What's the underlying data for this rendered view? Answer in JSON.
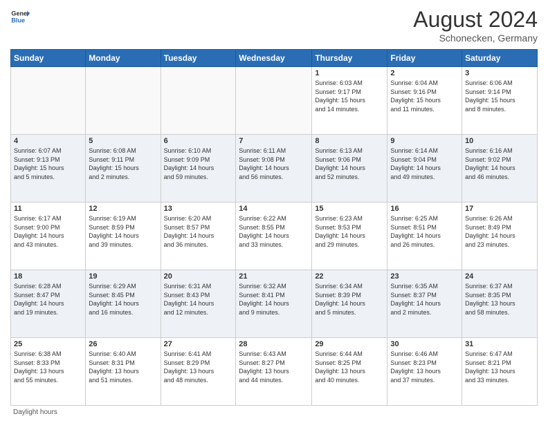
{
  "header": {
    "logo_general": "General",
    "logo_blue": "Blue",
    "month_year": "August 2024",
    "location": "Schonecken, Germany"
  },
  "days_of_week": [
    "Sunday",
    "Monday",
    "Tuesday",
    "Wednesday",
    "Thursday",
    "Friday",
    "Saturday"
  ],
  "weeks": [
    [
      {
        "day": "",
        "info": ""
      },
      {
        "day": "",
        "info": ""
      },
      {
        "day": "",
        "info": ""
      },
      {
        "day": "",
        "info": ""
      },
      {
        "day": "1",
        "info": "Sunrise: 6:03 AM\nSunset: 9:17 PM\nDaylight: 15 hours\nand 14 minutes."
      },
      {
        "day": "2",
        "info": "Sunrise: 6:04 AM\nSunset: 9:16 PM\nDaylight: 15 hours\nand 11 minutes."
      },
      {
        "day": "3",
        "info": "Sunrise: 6:06 AM\nSunset: 9:14 PM\nDaylight: 15 hours\nand 8 minutes."
      }
    ],
    [
      {
        "day": "4",
        "info": "Sunrise: 6:07 AM\nSunset: 9:13 PM\nDaylight: 15 hours\nand 5 minutes."
      },
      {
        "day": "5",
        "info": "Sunrise: 6:08 AM\nSunset: 9:11 PM\nDaylight: 15 hours\nand 2 minutes."
      },
      {
        "day": "6",
        "info": "Sunrise: 6:10 AM\nSunset: 9:09 PM\nDaylight: 14 hours\nand 59 minutes."
      },
      {
        "day": "7",
        "info": "Sunrise: 6:11 AM\nSunset: 9:08 PM\nDaylight: 14 hours\nand 56 minutes."
      },
      {
        "day": "8",
        "info": "Sunrise: 6:13 AM\nSunset: 9:06 PM\nDaylight: 14 hours\nand 52 minutes."
      },
      {
        "day": "9",
        "info": "Sunrise: 6:14 AM\nSunset: 9:04 PM\nDaylight: 14 hours\nand 49 minutes."
      },
      {
        "day": "10",
        "info": "Sunrise: 6:16 AM\nSunset: 9:02 PM\nDaylight: 14 hours\nand 46 minutes."
      }
    ],
    [
      {
        "day": "11",
        "info": "Sunrise: 6:17 AM\nSunset: 9:00 PM\nDaylight: 14 hours\nand 43 minutes."
      },
      {
        "day": "12",
        "info": "Sunrise: 6:19 AM\nSunset: 8:59 PM\nDaylight: 14 hours\nand 39 minutes."
      },
      {
        "day": "13",
        "info": "Sunrise: 6:20 AM\nSunset: 8:57 PM\nDaylight: 14 hours\nand 36 minutes."
      },
      {
        "day": "14",
        "info": "Sunrise: 6:22 AM\nSunset: 8:55 PM\nDaylight: 14 hours\nand 33 minutes."
      },
      {
        "day": "15",
        "info": "Sunrise: 6:23 AM\nSunset: 8:53 PM\nDaylight: 14 hours\nand 29 minutes."
      },
      {
        "day": "16",
        "info": "Sunrise: 6:25 AM\nSunset: 8:51 PM\nDaylight: 14 hours\nand 26 minutes."
      },
      {
        "day": "17",
        "info": "Sunrise: 6:26 AM\nSunset: 8:49 PM\nDaylight: 14 hours\nand 23 minutes."
      }
    ],
    [
      {
        "day": "18",
        "info": "Sunrise: 6:28 AM\nSunset: 8:47 PM\nDaylight: 14 hours\nand 19 minutes."
      },
      {
        "day": "19",
        "info": "Sunrise: 6:29 AM\nSunset: 8:45 PM\nDaylight: 14 hours\nand 16 minutes."
      },
      {
        "day": "20",
        "info": "Sunrise: 6:31 AM\nSunset: 8:43 PM\nDaylight: 14 hours\nand 12 minutes."
      },
      {
        "day": "21",
        "info": "Sunrise: 6:32 AM\nSunset: 8:41 PM\nDaylight: 14 hours\nand 9 minutes."
      },
      {
        "day": "22",
        "info": "Sunrise: 6:34 AM\nSunset: 8:39 PM\nDaylight: 14 hours\nand 5 minutes."
      },
      {
        "day": "23",
        "info": "Sunrise: 6:35 AM\nSunset: 8:37 PM\nDaylight: 14 hours\nand 2 minutes."
      },
      {
        "day": "24",
        "info": "Sunrise: 6:37 AM\nSunset: 8:35 PM\nDaylight: 13 hours\nand 58 minutes."
      }
    ],
    [
      {
        "day": "25",
        "info": "Sunrise: 6:38 AM\nSunset: 8:33 PM\nDaylight: 13 hours\nand 55 minutes."
      },
      {
        "day": "26",
        "info": "Sunrise: 6:40 AM\nSunset: 8:31 PM\nDaylight: 13 hours\nand 51 minutes."
      },
      {
        "day": "27",
        "info": "Sunrise: 6:41 AM\nSunset: 8:29 PM\nDaylight: 13 hours\nand 48 minutes."
      },
      {
        "day": "28",
        "info": "Sunrise: 6:43 AM\nSunset: 8:27 PM\nDaylight: 13 hours\nand 44 minutes."
      },
      {
        "day": "29",
        "info": "Sunrise: 6:44 AM\nSunset: 8:25 PM\nDaylight: 13 hours\nand 40 minutes."
      },
      {
        "day": "30",
        "info": "Sunrise: 6:46 AM\nSunset: 8:23 PM\nDaylight: 13 hours\nand 37 minutes."
      },
      {
        "day": "31",
        "info": "Sunrise: 6:47 AM\nSunset: 8:21 PM\nDaylight: 13 hours\nand 33 minutes."
      }
    ]
  ],
  "legend": {
    "daylight_label": "Daylight hours"
  }
}
